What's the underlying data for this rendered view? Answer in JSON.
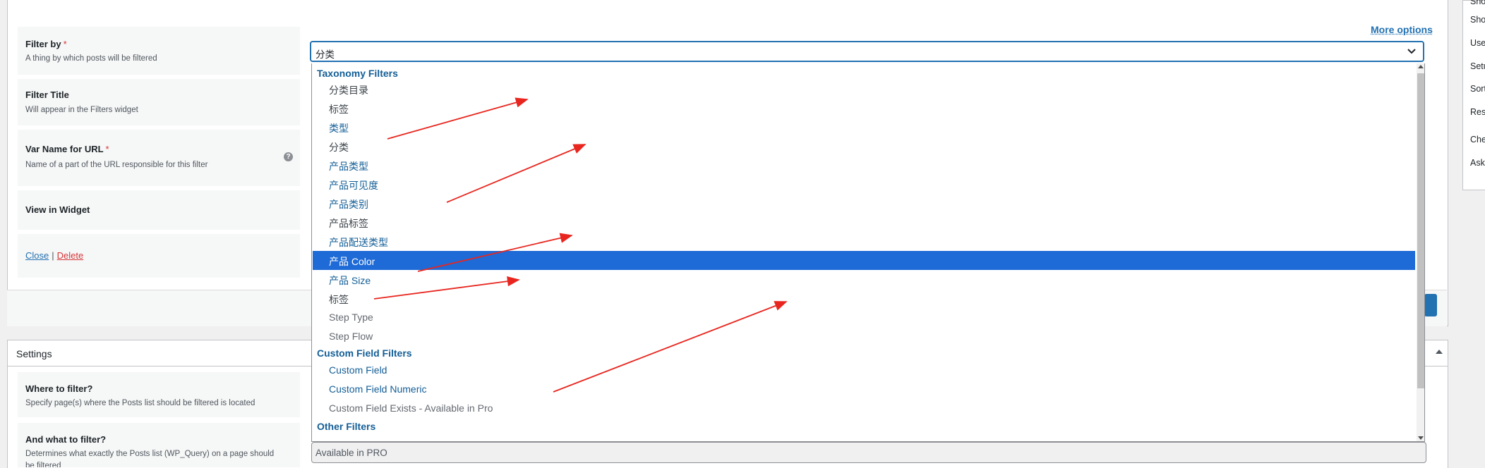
{
  "filter_form": {
    "more_options": "More options",
    "rows": {
      "filter_by": {
        "title": "Filter by",
        "required_mark": "*",
        "desc": "A thing by which posts will be filtered"
      },
      "filter_title": {
        "title": "Filter Title",
        "desc": "Will appear in the Filters widget"
      },
      "var_name": {
        "title": "Var Name for URL",
        "required_mark": "*",
        "desc": "Name of a part of the URL responsible for this filter"
      },
      "view_in_widget": {
        "title": "View in Widget"
      }
    },
    "help_icon": "?",
    "links": {
      "close": "Close",
      "separator": "|",
      "delete": "Delete"
    }
  },
  "select": {
    "value": "分类",
    "icon": "chevron-down-icon",
    "groups": [
      {
        "label": "Taxonomy Filters",
        "options": [
          {
            "label": "分类目录",
            "style": "normal"
          },
          {
            "label": "标签",
            "style": "normal"
          },
          {
            "label": "类型",
            "style": "blue"
          },
          {
            "label": "分类",
            "style": "normal"
          },
          {
            "label": "产品类型",
            "style": "blue"
          },
          {
            "label": "产品可见度",
            "style": "blue"
          },
          {
            "label": "产品类别",
            "style": "blue"
          },
          {
            "label": "产品标签",
            "style": "normal"
          },
          {
            "label": "产品配送类型",
            "style": "blue"
          },
          {
            "label": "产品 Color",
            "style": "selected"
          },
          {
            "label": "产品 Size",
            "style": "blue"
          },
          {
            "label": "标签",
            "style": "normal"
          },
          {
            "label": "Step Type",
            "style": "gray"
          },
          {
            "label": "Step Flow",
            "style": "gray"
          }
        ]
      },
      {
        "label": "Custom Field Filters",
        "options": [
          {
            "label": "Custom Field",
            "style": "blue"
          },
          {
            "label": "Custom Field Numeric",
            "style": "blue"
          },
          {
            "label": "Custom Field Exists - Available in Pro",
            "style": "gray"
          }
        ]
      },
      {
        "label": "Other Filters",
        "options": []
      }
    ]
  },
  "settings": {
    "title": "Settings",
    "where": {
      "title": "Where to filter?",
      "desc": "Specify page(s) where the Posts list should be filtered is located"
    },
    "what": {
      "title": "And what to filter?",
      "desc": "Determines what exactly the Posts list (WP_Query) on a page should",
      "desc2": "be filtered"
    },
    "available_value": "Available in PRO"
  },
  "right_sidebar": [
    "Sho",
    "Use",
    "Setu",
    "Sort",
    "Res",
    "Che",
    "Ask"
  ],
  "colors": {
    "accent": "#2271b1",
    "selected": "#1e6ad6",
    "annotation": "#e8261f",
    "delete": "#d63638"
  }
}
